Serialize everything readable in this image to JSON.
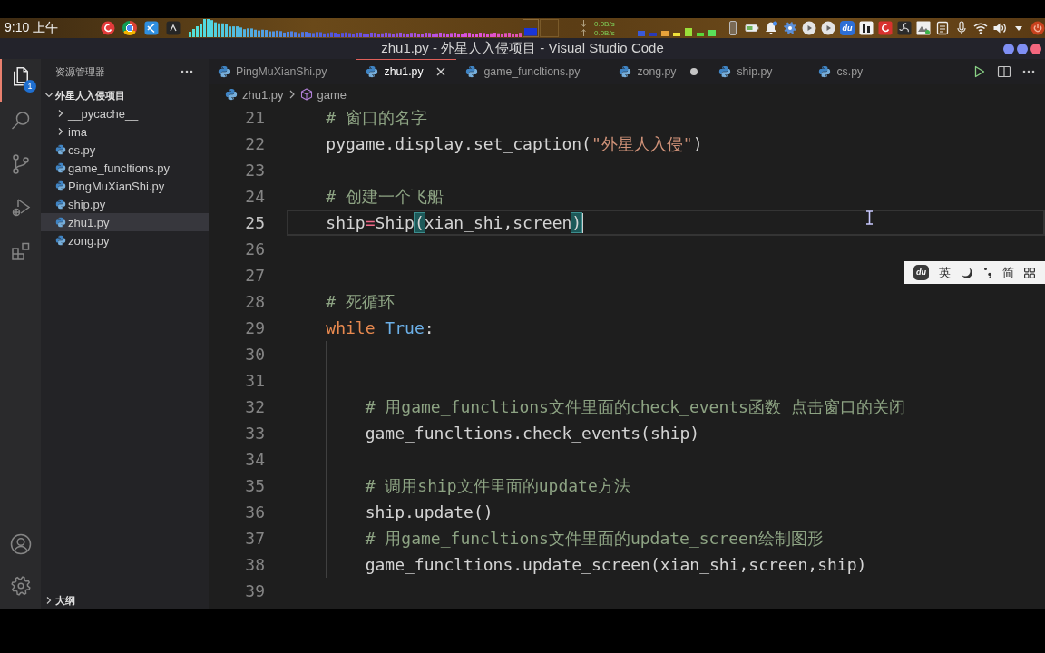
{
  "system_bar": {
    "clock": "9:10 上午",
    "download_speed": "0.0B/s",
    "upload_speed": "0.0B/s",
    "tray_badge": "du"
  },
  "window": {
    "title": "zhu1.py - 外星人入侵项目 - Visual Studio Code"
  },
  "activity_bar": {
    "items": [
      {
        "selected": true,
        "badge": "1"
      },
      {
        "selected": false
      },
      {
        "selected": false
      },
      {
        "selected": false
      },
      {
        "selected": false
      }
    ]
  },
  "explorer": {
    "title": "资源管理器",
    "root": {
      "name": "外星人入侵项目",
      "expanded": true,
      "children": [
        {
          "name": "__pycache__",
          "kind": "folder",
          "expanded": false,
          "selected": false
        },
        {
          "name": "ima",
          "kind": "folder",
          "expanded": false,
          "selected": false
        },
        {
          "name": "cs.py",
          "kind": "file",
          "selected": false
        },
        {
          "name": "game_funcltions.py",
          "kind": "file",
          "selected": false
        },
        {
          "name": "PingMuXianShi.py",
          "kind": "file",
          "selected": false
        },
        {
          "name": "ship.py",
          "kind": "file",
          "selected": false
        },
        {
          "name": "zhu1.py",
          "kind": "file",
          "selected": true
        },
        {
          "name": "zong.py",
          "kind": "file",
          "selected": false
        }
      ]
    },
    "outline": {
      "name": "大纲",
      "expanded": false
    }
  },
  "tabs": [
    {
      "label": "PingMuXianShi.py",
      "selected": false,
      "modified": false
    },
    {
      "label": "zhu1.py",
      "selected": true,
      "modified": false
    },
    {
      "label": "game_funcltions.py",
      "selected": false,
      "modified": false
    },
    {
      "label": "zong.py",
      "selected": false,
      "modified": true
    },
    {
      "label": "ship.py",
      "selected": false,
      "modified": false
    },
    {
      "label": "cs.py",
      "selected": false,
      "modified": false
    }
  ],
  "breadcrumb": [
    {
      "label": "zhu1.py",
      "kind": "file"
    },
    {
      "label": "game",
      "kind": "symbol"
    }
  ],
  "code": {
    "lines": [
      {
        "number": "21",
        "current": false,
        "tokens": [
          {
            "text": "# 窗口的名字",
            "kind": "comment"
          }
        ]
      },
      {
        "number": "22",
        "current": false,
        "tokens": [
          {
            "text": "pygame.display.set_caption(",
            "kind": "plain"
          },
          {
            "text": "\"外星人入侵\"",
            "kind": "string"
          },
          {
            "text": ")",
            "kind": "plain"
          }
        ]
      },
      {
        "number": "23",
        "current": false
      },
      {
        "number": "24",
        "current": false,
        "tokens": [
          {
            "text": "# 创建一个飞船",
            "kind": "comment"
          }
        ]
      },
      {
        "number": "25",
        "current": true,
        "tokens": [
          {
            "text": "ship",
            "kind": "plain"
          },
          {
            "text": "=",
            "kind": "operator"
          },
          {
            "text": "Ship",
            "kind": "plain"
          },
          {
            "text": "(",
            "kind": "matched-bracket"
          },
          {
            "text": "xian_shi,screen",
            "kind": "plain"
          },
          {
            "text": ")",
            "kind": "matched-bracket"
          }
        ]
      },
      {
        "number": "26",
        "current": false
      },
      {
        "number": "27",
        "current": false
      },
      {
        "number": "28",
        "current": false,
        "tokens": [
          {
            "text": "# 死循环",
            "kind": "comment"
          }
        ]
      },
      {
        "number": "29",
        "current": false,
        "tokens": [
          {
            "text": "while",
            "kind": "keyword"
          },
          {
            "text": " True",
            "kind": "constant"
          },
          {
            "text": ":",
            "kind": "plain"
          }
        ],
        "children": [
          {
            "number": "30",
            "current": false
          },
          {
            "number": "31",
            "current": false
          },
          {
            "number": "32",
            "current": false,
            "tokens": [
              {
                "text": "# 用game_funcltions文件里面的check_events函数 点击窗口的关闭",
                "kind": "comment"
              }
            ]
          },
          {
            "number": "33",
            "current": false,
            "tokens": [
              {
                "text": "game_funcltions.check_events(ship)",
                "kind": "plain"
              }
            ]
          },
          {
            "number": "34",
            "current": false
          },
          {
            "number": "35",
            "current": false,
            "tokens": [
              {
                "text": "# 调用ship文件里面的update方法",
                "kind": "comment"
              }
            ]
          },
          {
            "number": "36",
            "current": false,
            "tokens": [
              {
                "text": "ship.update()",
                "kind": "plain"
              }
            ]
          },
          {
            "number": "37",
            "current": false,
            "tokens": [
              {
                "text": "# 用game_funcltions文件里面的update_screen绘制图形",
                "kind": "comment"
              }
            ]
          },
          {
            "number": "38",
            "current": false,
            "tokens": [
              {
                "text": "game_funcltions.update_screen(xian_shi,screen,ship)",
                "kind": "plain"
              }
            ]
          }
        ]
      },
      {
        "number": "39",
        "current": false
      }
    ]
  },
  "ime_bar": {
    "logo": "du",
    "language": "英",
    "charset": "简"
  }
}
